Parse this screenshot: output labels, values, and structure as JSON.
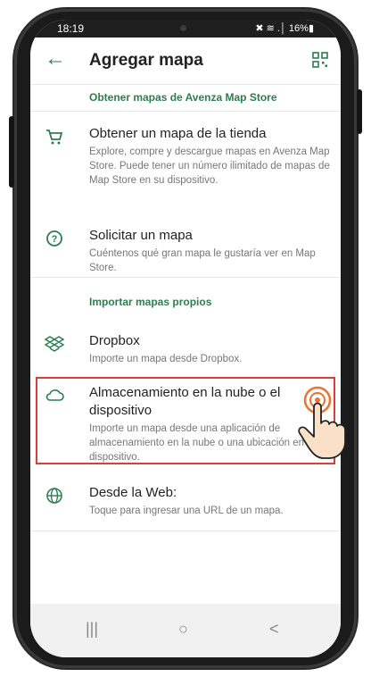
{
  "status": {
    "time": "18:19",
    "icons": "✖ ≋ .│ 16%▮"
  },
  "header": {
    "title": "Agregar mapa",
    "back_icon": "back-arrow-icon",
    "qr_icon": "qr-code-icon"
  },
  "sections": {
    "store": "Obtener mapas de Avenza Map Store",
    "import": "Importar mapas propios"
  },
  "items": {
    "store_map": {
      "title": "Obtener un mapa de la tienda",
      "desc": "Explore, compre y descargue mapas en Avenza Map Store. Puede tener un número ilimitado de mapas de Map Store en su dispositivo.",
      "icon": "cart-icon"
    },
    "request_map": {
      "title": "Solicitar un mapa",
      "desc": "Cuéntenos qué gran mapa le gustaría ver en Map Store.",
      "icon": "question-icon"
    },
    "dropbox": {
      "title": "Dropbox",
      "desc": "Importe un mapa desde Dropbox.",
      "icon": "dropbox-icon"
    },
    "cloud": {
      "title": "Almacenamiento en la nube o el dispositivo",
      "desc": "Importe un mapa desde una aplicación de almacenamiento en la nube o una ubicación en su dispositivo.",
      "icon": "cloud-icon"
    },
    "web": {
      "title": "Desde la Web:",
      "desc": "Toque para ingresar una URL de un mapa.",
      "icon": "globe-icon"
    }
  },
  "navbar": {
    "recent": "|||",
    "home": "○",
    "back": "<"
  },
  "colors": {
    "accent": "#2e7d4f",
    "highlight": "#e03a3a",
    "tap": "#f07030"
  }
}
